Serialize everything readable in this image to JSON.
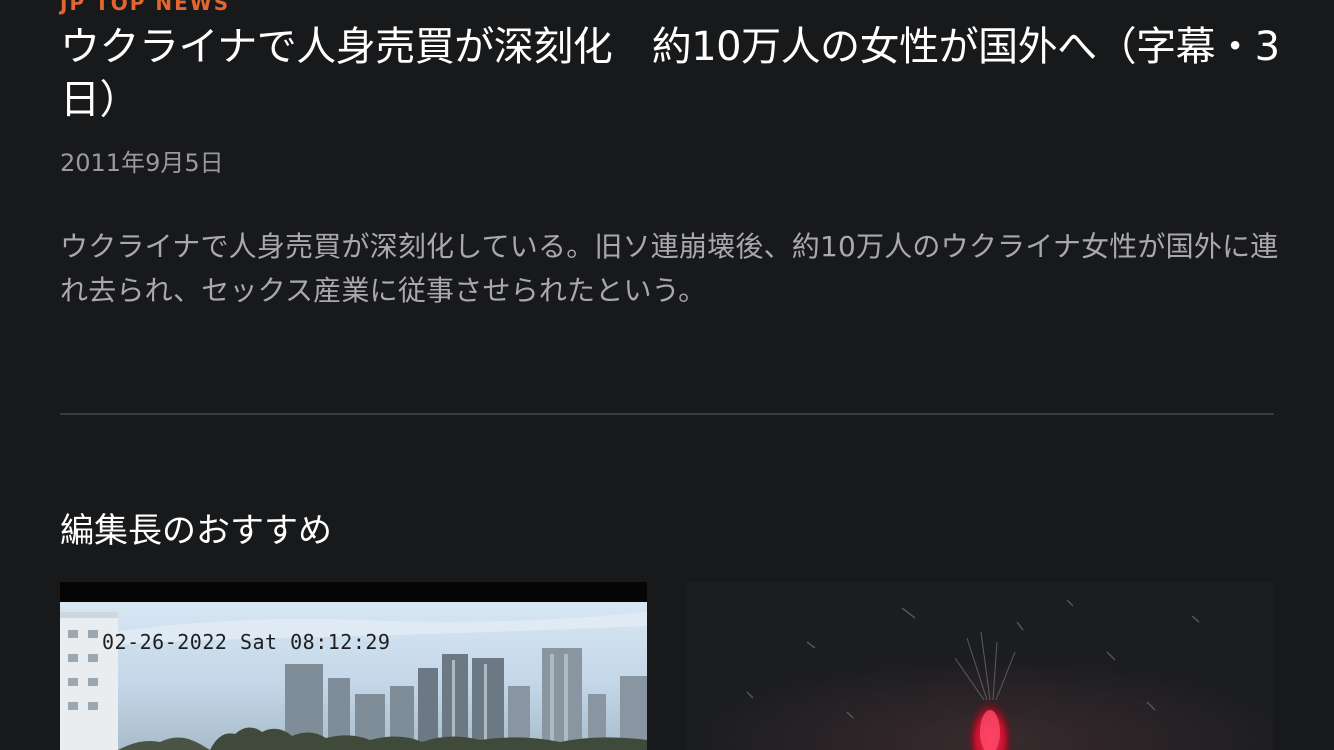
{
  "article": {
    "category": "JP TOP NEWS",
    "headline": "ウクライナで人身売買が深刻化　約10万人の女性が国外へ（字幕・3日）",
    "date": "2011年9月5日",
    "summary": "ウクライナで人身売買が深刻化している。旧ソ連崩壊後、約10万人のウクライナ女性が国外に連れ去られ、セックス産業に従事させられたという。"
  },
  "recommendations": {
    "title": "編集長のおすすめ",
    "cards": [
      {
        "image": "city-skyline-camera-still",
        "overlay_text": "02-26-2022 Sat 08:12:29"
      },
      {
        "image": "night-scene-red-flare"
      }
    ]
  },
  "colors": {
    "background": "#18191b",
    "accent": "#e2662e",
    "text": "#ffffff",
    "muted_text": "#a9a9ab"
  }
}
